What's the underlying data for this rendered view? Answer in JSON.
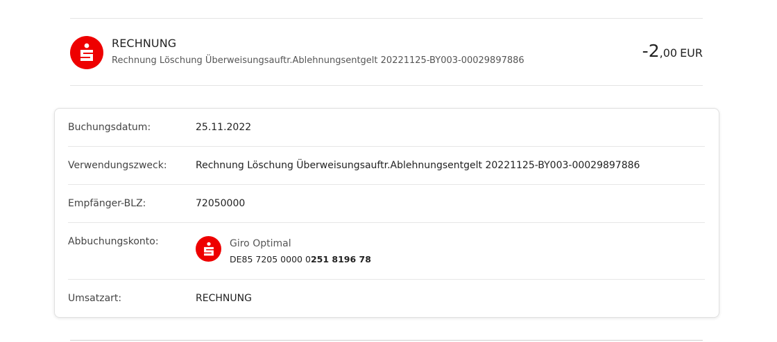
{
  "transaction": {
    "logo_icon": "sparkasse-s-icon",
    "title": "RECHNUNG",
    "subtitle": "Rechnung Löschung Überweisungsauftr.Ablehnungsentgelt 20221125-BY003-00029897886",
    "amount": {
      "integer_part": "-2",
      "decimal_part": ",00",
      "currency": "EUR"
    }
  },
  "details": {
    "booking_date": {
      "label": "Buchungsdatum:",
      "value": "25.11.2022"
    },
    "purpose": {
      "label": "Verwendungszweck:",
      "value": "Rechnung Löschung Überweisungsauftr.Ablehnungsentgelt 20221125-BY003-00029897886"
    },
    "recipient_blz": {
      "label": "Empfänger-BLZ:",
      "value": "72050000"
    },
    "debit_account": {
      "label": "Abbuchungskonto:",
      "account_name": "Giro Optimal",
      "iban_prefix": "DE85 7205 0000 0",
      "iban_highlight": "251 8196 78"
    },
    "transaction_type": {
      "label": "Umsatzart:",
      "value": "RECHNUNG"
    }
  },
  "colors": {
    "brand_red": "#ee0000",
    "divider": "#e6e6e6"
  }
}
